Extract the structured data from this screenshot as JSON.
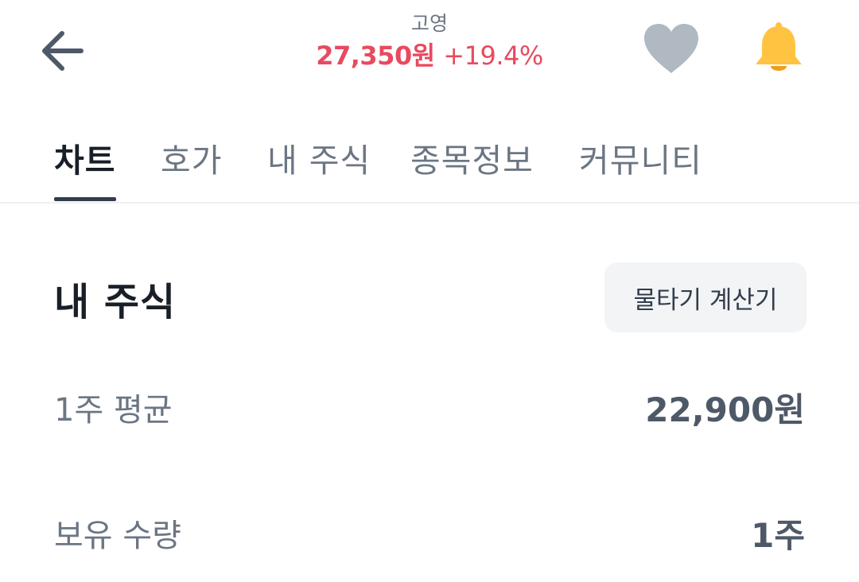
{
  "header": {
    "back_icon": "arrow-left-icon",
    "stock_name": "고영",
    "price": "27,350원",
    "change": "+19.4%",
    "price_color": "#e84a5f",
    "heart_icon": "heart-icon",
    "heart_color": "#b0b8c1",
    "bell_icon": "bell-icon",
    "bell_color": "#ffc342"
  },
  "tabs": [
    {
      "label": "차트",
      "active": true
    },
    {
      "label": "호가",
      "active": false
    },
    {
      "label": "내 주식",
      "active": false
    },
    {
      "label": "종목정보",
      "active": false
    },
    {
      "label": "커뮤니티",
      "active": false
    }
  ],
  "my_stock": {
    "title": "내 주식",
    "calc_button": "물타기 계산기",
    "rows": [
      {
        "label": "1주 평균",
        "value": "22,900원"
      },
      {
        "label": "보유 수량",
        "value": "1주"
      }
    ]
  }
}
